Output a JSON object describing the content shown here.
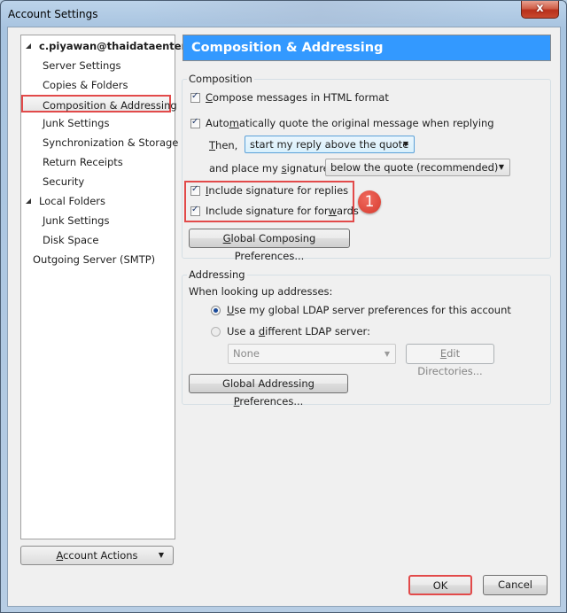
{
  "window": {
    "title": "Account Settings",
    "close_icon": "close-x-icon",
    "close_label": "x"
  },
  "sidebar": {
    "items": [
      {
        "label": "c.piyawan@thaidataenterp...",
        "level": 0,
        "expanded": true,
        "bold": true
      },
      {
        "label": "Server Settings",
        "level": 1
      },
      {
        "label": "Copies & Folders",
        "level": 1
      },
      {
        "label": "Composition & Addressing",
        "level": 1,
        "selected": true
      },
      {
        "label": "Junk Settings",
        "level": 1
      },
      {
        "label": "Synchronization & Storage",
        "level": 1
      },
      {
        "label": "Return Receipts",
        "level": 1
      },
      {
        "label": "Security",
        "level": 1
      },
      {
        "label": "Local Folders",
        "level": 0,
        "expanded": true
      },
      {
        "label": "Junk Settings",
        "level": 1
      },
      {
        "label": "Disk Space",
        "level": 1
      },
      {
        "label": "Outgoing Server (SMTP)",
        "level": 0
      }
    ],
    "account_actions": {
      "pre": "",
      "ul": "A",
      "post": "ccount Actions",
      "caret": "▼"
    }
  },
  "panel": {
    "header": "Composition & Addressing",
    "composition": {
      "legend": "Composition",
      "html_format": {
        "pre": "",
        "ul": "C",
        "post": "ompose messages in HTML format",
        "checked": true
      },
      "auto_quote": {
        "pre": "Auto",
        "ul": "m",
        "post": "atically quote the original message when replying",
        "checked": true
      },
      "then_label": {
        "pre": "",
        "ul": "T",
        "post": "hen,"
      },
      "then_value": "start my reply above the quote",
      "signature_label": {
        "pre": "and place my ",
        "ul": "s",
        "post": "ignature"
      },
      "signature_value": "below the quote (recommended)",
      "sig_replies": {
        "pre": "",
        "ul": "I",
        "post": "nclude signature for replies",
        "checked": true
      },
      "sig_forwards": {
        "pre": "Include signature for for",
        "ul": "w",
        "post": "ards",
        "checked": true
      },
      "global_composing": {
        "pre": "",
        "ul": "G",
        "post": "lobal Composing Preferences..."
      }
    },
    "annotation_badge": "1",
    "addressing": {
      "legend": "Addressing",
      "lookup_label": "When looking up addresses:",
      "use_global": {
        "pre": "",
        "ul": "U",
        "post": "se my global LDAP server preferences for this account",
        "selected": true
      },
      "use_different": {
        "pre": "Use a ",
        "ul": "d",
        "post": "ifferent LDAP server:",
        "selected": false
      },
      "ldap_select": "None",
      "edit_directories": {
        "pre": "",
        "ul": "E",
        "post": "dit Directories..."
      },
      "global_addressing": {
        "pre": "Global Addressing ",
        "ul": "P",
        "post": "references..."
      }
    }
  },
  "footer": {
    "ok": "OK",
    "cancel": "Cancel"
  },
  "colors": {
    "header_bg": "#3399ff",
    "annotation_red": "#e24a4a"
  }
}
